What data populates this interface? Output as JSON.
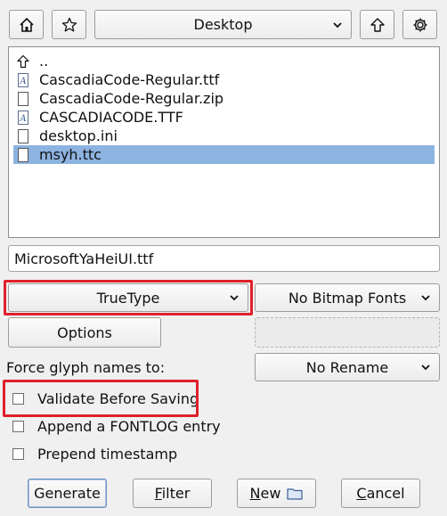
{
  "toolbar": {
    "home_icon": "home-icon",
    "bookmark_icon": "star-icon",
    "directory": "Desktop",
    "up_icon": "arrow-up-icon",
    "settings_icon": "gear-icon"
  },
  "files": [
    {
      "name": "..",
      "icon": "parent-dir-icon",
      "selected": false
    },
    {
      "name": "CascadiaCode-Regular.ttf",
      "icon": "font-file-icon",
      "selected": false
    },
    {
      "name": "CascadiaCode-Regular.zip",
      "icon": "file-icon",
      "selected": false
    },
    {
      "name": "CASCADIACODE.TTF",
      "icon": "font-file-icon",
      "selected": false
    },
    {
      "name": "desktop.ini",
      "icon": "file-icon",
      "selected": false
    },
    {
      "name": "msyh.ttc",
      "icon": "file-icon",
      "selected": true
    }
  ],
  "filename": "MicrosoftYaHeiUI.ttf",
  "format": {
    "outline": "TrueType",
    "bitmap": "No Bitmap Fonts"
  },
  "options_label": "Options",
  "force_glyph_names": {
    "label": "Force glyph names to:",
    "value": "No Rename"
  },
  "checkboxes": {
    "validate": {
      "label": "Validate Before Saving",
      "checked": false
    },
    "fontlog": {
      "label": "Append a FONTLOG entry",
      "checked": false
    },
    "timestamp": {
      "label": "Prepend timestamp",
      "checked": false
    }
  },
  "buttons": {
    "generate": "Generate",
    "filter_first": "F",
    "filter_rest": "ilter",
    "new_first": "N",
    "new_rest": "ew",
    "cancel_first": "C",
    "cancel_rest": "ancel"
  },
  "colors": {
    "selection": "#8db3e0",
    "highlight": "#e0202a"
  }
}
